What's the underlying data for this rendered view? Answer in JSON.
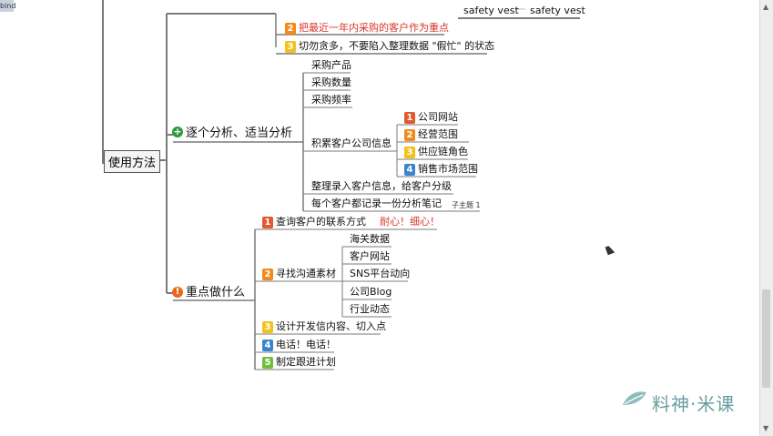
{
  "window": {
    "tab_label": "bind"
  },
  "top_partial": {
    "left_cell": "safety vest",
    "right_cell": "safety vest"
  },
  "root": {
    "label": "使用方法"
  },
  "top_items": [
    {
      "num": "2",
      "label": "把最近一年内采购的客户作为重点"
    },
    {
      "num": "3",
      "label": "切勿贪多，不要陷入整理数据 \"假忙\" 的状态"
    }
  ],
  "branch1": {
    "label": "逐个分析、适当分析",
    "items": [
      "采购产品",
      "采购数量",
      "采购频率",
      "积累客户公司信息",
      "整理录入客户信息，给客户分级",
      "每个客户都记录一份分析笔记"
    ],
    "sub_items": [
      {
        "num": "1",
        "label": "公司网站"
      },
      {
        "num": "2",
        "label": "经营范围"
      },
      {
        "num": "3",
        "label": "供应链角色"
      },
      {
        "num": "4",
        "label": "销售市场范围"
      }
    ],
    "note_tag": "子主题 1"
  },
  "branch2": {
    "label": "重点做什么",
    "items": [
      {
        "num": "1",
        "label": "查询客户的联系方式",
        "note": "耐心！细心！"
      },
      {
        "num": "2",
        "label": "寻找沟通素材"
      },
      {
        "num": "3",
        "label": "设计开发信内容、切入点"
      },
      {
        "num": "4",
        "label": "电话！电话！"
      },
      {
        "num": "5",
        "label": "制定跟进计划"
      }
    ],
    "material_items": [
      "海关数据",
      "客户网站",
      "SNS平台动向",
      "公司Blog",
      "行业动态"
    ]
  },
  "watermark": {
    "text": "料神·米课"
  },
  "colors": {
    "line": "#7a7a7a",
    "red_text": "#d9342b",
    "green_icon": "#2e9a3a",
    "orange_icon": "#e8681c",
    "watermark": "#6a9ea0"
  }
}
